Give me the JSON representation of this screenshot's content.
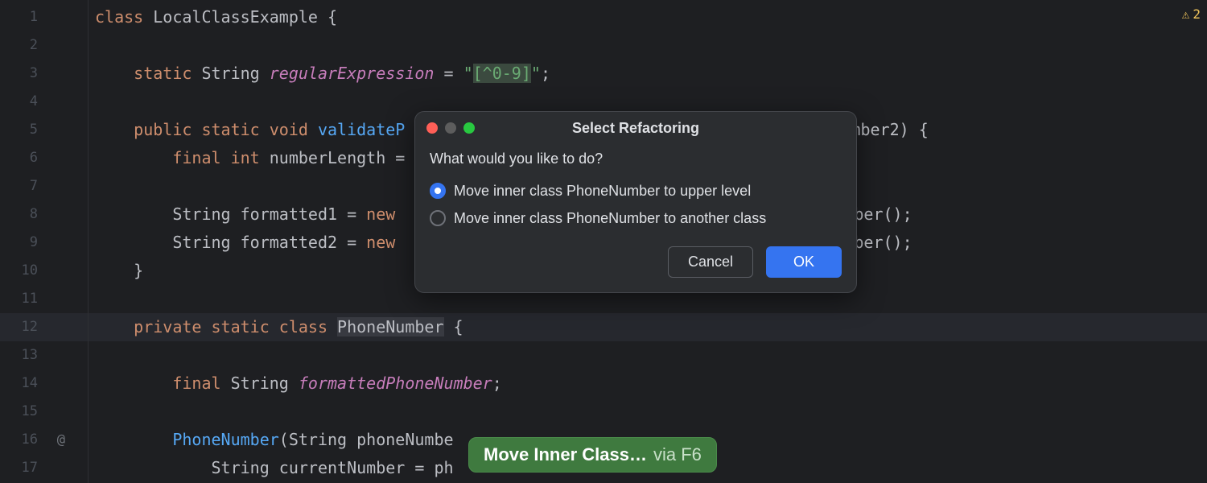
{
  "gutter": {
    "lines": [
      "1",
      "2",
      "3",
      "4",
      "5",
      "6",
      "7",
      "8",
      "9",
      "10",
      "11",
      "12",
      "13",
      "14",
      "15",
      "16",
      "17"
    ],
    "at_icon_line": 16,
    "at_icon": "@"
  },
  "warning": {
    "icon": "⚠",
    "count": "2"
  },
  "code": {
    "l1": {
      "kw": "class",
      "name": "LocalClassExample",
      "brace": " {"
    },
    "l3": {
      "kw1": "static",
      "type": "String",
      "field": "regularExpression",
      "eq": " = ",
      "q1": "\"",
      "str": "[^0-9]",
      "q2": "\"",
      "semi": ";"
    },
    "l5": {
      "kw": "public static void",
      "method": "validateP",
      "tail": "Number2) {"
    },
    "l6": {
      "kw": "final int",
      "var": "numberLength",
      "eq": " ="
    },
    "l8": {
      "type": "String",
      "var": "formatted1 = ",
      "kw": "new",
      "tail": "umber();"
    },
    "l9": {
      "type": "String",
      "var": "formatted2 = ",
      "kw": "new",
      "tail": "umber();"
    },
    "l10": {
      "brace": "}"
    },
    "l12": {
      "kw": "private static class",
      "name": "PhoneNumber",
      "brace": " {"
    },
    "l14": {
      "kw": "final",
      "type": "String",
      "field": "formattedPhoneNumber",
      "semi": ";"
    },
    "l16": {
      "method": "PhoneNumber",
      "open": "(",
      "type": "String",
      "param": "phoneNumbe"
    },
    "l17": {
      "type": "String",
      "var": "currentNumber = ph"
    }
  },
  "dialog": {
    "title": "Select Refactoring",
    "prompt": "What would you like to do?",
    "option1": "Move inner class PhoneNumber to upper level",
    "option2": "Move inner class PhoneNumber to another class",
    "cancel": "Cancel",
    "ok": "OK"
  },
  "hint": {
    "action": "Move Inner Class…",
    "via": "via F6"
  }
}
